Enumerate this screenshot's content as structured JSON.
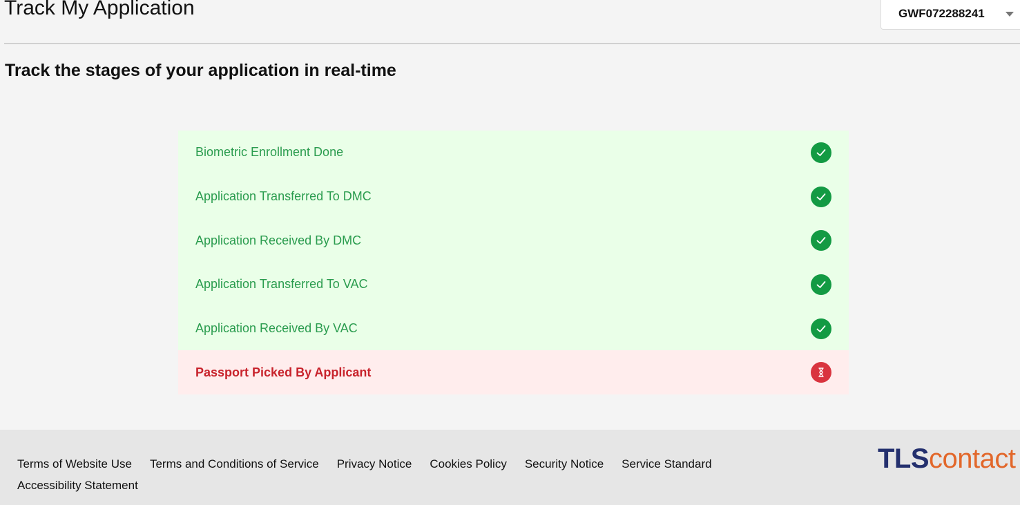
{
  "page": {
    "title": "Track My Application",
    "subtitle": "Track the stages of your application in real-time"
  },
  "application_selector": {
    "selected": "GWF072288241"
  },
  "stages": [
    {
      "label": "Biometric Enrollment Done",
      "status": "done",
      "icon": "check-icon"
    },
    {
      "label": "Application Transferred To DMC",
      "status": "done",
      "icon": "check-icon"
    },
    {
      "label": "Application Received By DMC",
      "status": "done",
      "icon": "check-icon"
    },
    {
      "label": "Application Transferred To VAC",
      "status": "done",
      "icon": "check-icon"
    },
    {
      "label": "Application Received By VAC",
      "status": "done",
      "icon": "check-icon"
    },
    {
      "label": "Passport Picked By Applicant",
      "status": "pending",
      "icon": "hourglass-icon"
    }
  ],
  "footer": {
    "links": [
      "Terms of Website Use",
      "Terms and Conditions of Service",
      "Privacy Notice",
      "Cookies Policy",
      "Security Notice",
      "Service Standard",
      "Accessibility Statement"
    ],
    "logo": {
      "part1": "TLS",
      "part2": "contact"
    }
  },
  "colors": {
    "done_text": "#2a9c4e",
    "done_bg": "#eaffe8",
    "done_icon": "#139a43",
    "pending_text": "#c8232c",
    "pending_bg": "#ffeded",
    "pending_icon": "#d9343f",
    "logo_tls": "#24306e",
    "logo_contact": "#e2672a"
  }
}
